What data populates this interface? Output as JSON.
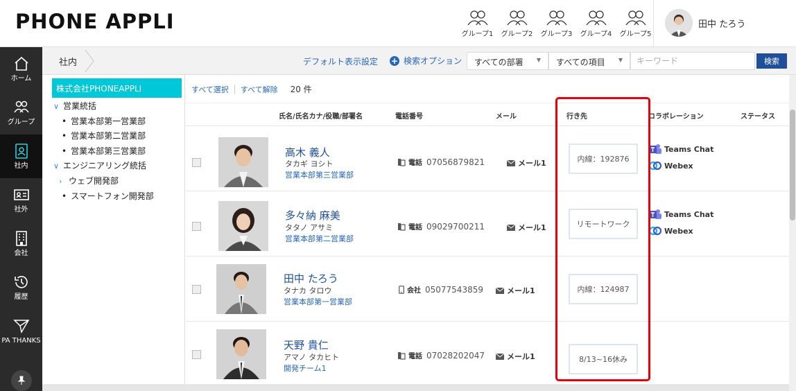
{
  "header": {
    "logo": "PHONE APPLI",
    "groups": [
      "グループ1",
      "グループ2",
      "グループ3",
      "グループ4",
      "グループ5"
    ],
    "user_name": "田中 たろう"
  },
  "nav": [
    {
      "label": "ホーム",
      "icon": "home-icon"
    },
    {
      "label": "グループ",
      "icon": "people-icon"
    },
    {
      "label": "社内",
      "icon": "id-card-icon",
      "active": true
    },
    {
      "label": "社外",
      "icon": "business-card-icon"
    },
    {
      "label": "会社",
      "icon": "building-icon"
    },
    {
      "label": "履歴",
      "icon": "history-icon"
    },
    {
      "label": "PA THANKS",
      "icon": "paper-plane-icon"
    }
  ],
  "toolbar": {
    "breadcrumb": "社内",
    "default_view": "デフォルト表示設定",
    "search_options": "検索オプション",
    "dept_select": "すべての部署",
    "item_select": "すべての項目",
    "keyword_placeholder": "キーワード",
    "search_button": "検索"
  },
  "tree": {
    "root": "株式会社PHONEAPPLI",
    "group1": "営業統括",
    "group1_children": [
      "営業本部第一営業部",
      "営業本部第二営業部",
      "営業本部第三営業部"
    ],
    "group2": "エンジニアリング統括",
    "group2_children": [
      "ウェブ開発部",
      "スマートフォン開発部"
    ]
  },
  "list": {
    "select_all": "すべて選択",
    "deselect_all": "すべて解除",
    "count": "20 件",
    "columns": [
      "氏名/氏名カナ/役職/部署名",
      "電話番号",
      "メール",
      "行き先",
      "コラボレーション",
      "ステータス"
    ],
    "rows": [
      {
        "name": "高木 義人",
        "kana": "タカギ ヨシト",
        "dept": "営業本部第三営業部",
        "phone_type": "電話",
        "phone": "07056879821",
        "mail": "メール1",
        "destination": "内線：192876",
        "collab": [
          "Teams Chat",
          "Webex"
        ]
      },
      {
        "name": "多々納 麻美",
        "kana": "タタノ アサミ",
        "dept": "営業本部第二営業部",
        "phone_type": "電話",
        "phone": "09029700211",
        "mail": "メール1",
        "destination": "リモートワーク",
        "collab": [
          "Teams Chat",
          "Webex"
        ]
      },
      {
        "name": "田中 たろう",
        "kana": "タナカ タロウ",
        "dept": "営業本部第一営業部",
        "phone_type": "会社",
        "phone": "05077543859",
        "mail": "メール1",
        "destination": "内線：124987",
        "collab": []
      },
      {
        "name": "天野 貴仁",
        "kana": "アマノ タカヒト",
        "dept": "開発チーム1",
        "phone_type": "電話",
        "phone": "07028202047",
        "mail": "メール1",
        "destination": "8/13~16休み",
        "collab": []
      }
    ]
  },
  "colors": {
    "accent_cyan": "#00c8d8",
    "link_blue": "#2a66b8",
    "highlight_red": "#e8000b",
    "nav_bg": "#2b2b2b"
  }
}
